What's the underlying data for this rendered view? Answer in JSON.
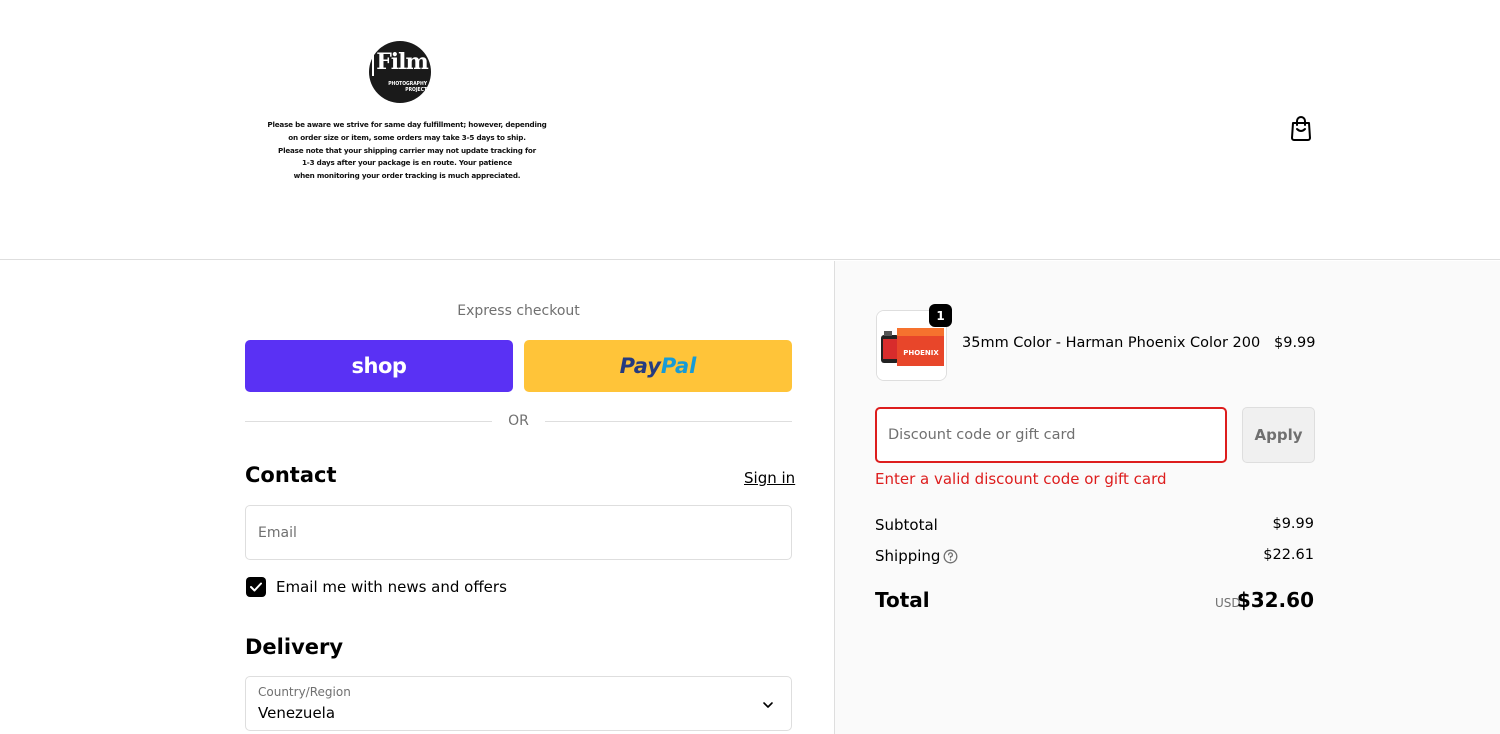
{
  "header": {
    "logo": {
      "mark": "Film",
      "sub_lines": [
        "PHOTOGRAPHY",
        "PROJECT"
      ]
    },
    "notice_lines": [
      "Please be aware we strive for same day fulfillment; however, depending",
      "on order size or item, some orders may take 3-5 days to ship.",
      "Please note that your shipping carrier may not update tracking for",
      "1-3 days after your package is en route. Your patience",
      "when monitoring your order tracking is much appreciated."
    ],
    "cart_icon": "shopping-bag-icon"
  },
  "express": {
    "label": "Express checkout",
    "shop_label": "shop",
    "paypal_part1": "Pay",
    "paypal_part2": "Pal",
    "or_label": "OR"
  },
  "contact": {
    "title": "Contact",
    "signin_label": "Sign in",
    "email_placeholder": "Email",
    "email_value": "",
    "marketing_label": "Email me with news and offers",
    "marketing_checked": true
  },
  "delivery": {
    "title": "Delivery",
    "country_label": "Country/Region",
    "country_value": "Venezuela"
  },
  "summary": {
    "item": {
      "quantity": "1",
      "name": "35mm Color - Harman Phoenix Color 200",
      "price": "$9.99",
      "thumb_text": "PHOENIX"
    },
    "discount": {
      "placeholder": "Discount code or gift card",
      "value": "",
      "apply_label": "Apply",
      "error": "Enter a valid discount code or gift card"
    },
    "subtotal_label": "Subtotal",
    "subtotal_value": "$9.99",
    "shipping_label": "Shipping",
    "shipping_value": "$22.61",
    "total_label": "Total",
    "total_currency": "USD",
    "total_value": "$32.60"
  },
  "colors": {
    "shop_purple": "#5a31f4",
    "paypal_yellow": "#ffc439",
    "paypal_dark_blue": "#253b80",
    "paypal_light_blue": "#179bd7",
    "error_red": "#dd1d1d",
    "muted_text": "#707070",
    "border": "#dedede",
    "summary_bg": "#fafafa"
  }
}
